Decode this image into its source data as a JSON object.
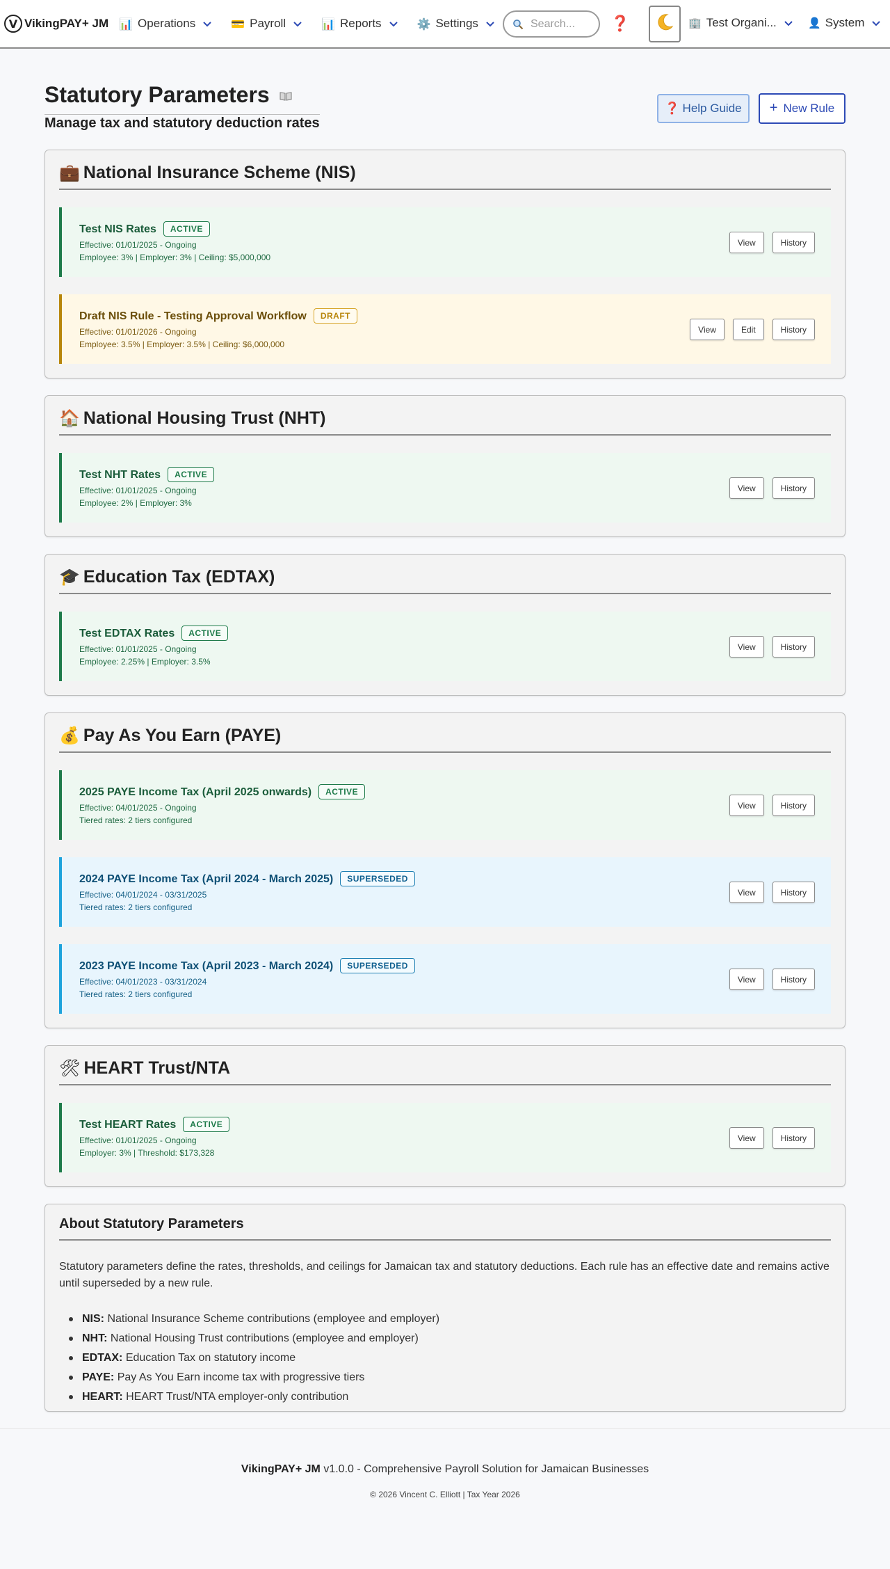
{
  "nav": {
    "brand_logo": "V",
    "brand": "VikingPAY+ JM",
    "menu": [
      {
        "icon": "📊",
        "label": "Operations"
      },
      {
        "icon": "💳",
        "label": "Payroll"
      },
      {
        "icon": "📊",
        "label": "Reports"
      },
      {
        "icon": "⚙️",
        "label": "Settings"
      }
    ],
    "search_placeholder": "Search...",
    "help_glyph": "❓",
    "theme_glyph": "🌙",
    "org": {
      "icon": "🏢",
      "label": "Test Organi..."
    },
    "user": {
      "icon": "👤",
      "label": "System"
    }
  },
  "header": {
    "title": "Statutory Parameters",
    "subtitle": "Manage tax and statutory deduction rates",
    "help_button": "Help Guide",
    "help_glyph": "❓",
    "new_button": "New Rule",
    "new_glyph": "+"
  },
  "buttons": {
    "view": "View",
    "edit": "Edit",
    "history": "History"
  },
  "sections": [
    {
      "icon": "💼",
      "title": "National Insurance Scheme (NIS)",
      "rules": [
        {
          "name": "Test NIS Rates",
          "status": "ACTIVE",
          "effective": "Effective: 01/01/2025 - Ongoing",
          "detail": "Employee: 3% | Employer: 3% | Ceiling: $5,000,000"
        },
        {
          "name": "Draft NIS Rule - Testing Approval Workflow",
          "status": "DRAFT",
          "effective": "Effective: 01/01/2026 - Ongoing",
          "detail": "Employee: 3.5% | Employer: 3.5% | Ceiling: $6,000,000"
        }
      ]
    },
    {
      "icon": "🏠",
      "title": "National Housing Trust (NHT)",
      "rules": [
        {
          "name": "Test NHT Rates",
          "status": "ACTIVE",
          "effective": "Effective: 01/01/2025 - Ongoing",
          "detail": "Employee: 2% | Employer: 3%"
        }
      ]
    },
    {
      "icon": "🎓",
      "title": "Education Tax (EDTAX)",
      "rules": [
        {
          "name": "Test EDTAX Rates",
          "status": "ACTIVE",
          "effective": "Effective: 01/01/2025 - Ongoing",
          "detail": "Employee: 2.25% | Employer: 3.5%"
        }
      ]
    },
    {
      "icon": "💰",
      "title": "Pay As You Earn (PAYE)",
      "rules": [
        {
          "name": "2025 PAYE Income Tax (April 2025 onwards)",
          "status": "ACTIVE",
          "effective": "Effective: 04/01/2025 - Ongoing",
          "detail": "Tiered rates: 2 tiers configured"
        },
        {
          "name": "2024 PAYE Income Tax (April 2024 - March 2025)",
          "status": "SUPERSEDED",
          "effective": "Effective: 04/01/2024 - 03/31/2025",
          "detail": "Tiered rates: 2 tiers configured"
        },
        {
          "name": "2023 PAYE Income Tax (April 2023 - March 2024)",
          "status": "SUPERSEDED",
          "effective": "Effective: 04/01/2023 - 03/31/2024",
          "detail": "Tiered rates: 2 tiers configured"
        }
      ]
    },
    {
      "icon": "🛠",
      "title": "HEART Trust/NTA",
      "rules": [
        {
          "name": "Test HEART Rates",
          "status": "ACTIVE",
          "effective": "Effective: 01/01/2025 - Ongoing",
          "detail": "Employer: 3% | Threshold: $173,328"
        }
      ]
    }
  ],
  "about": {
    "title": "About Statutory Parameters",
    "text": "Statutory parameters define the rates, thresholds, and ceilings for Jamaican tax and statutory deductions. Each rule has an effective date and remains active until superseded by a new rule.",
    "items": [
      {
        "term": "NIS:",
        "desc": " National Insurance Scheme contributions (employee and employer)"
      },
      {
        "term": "NHT:",
        "desc": " National Housing Trust contributions (employee and employer)"
      },
      {
        "term": "EDTAX:",
        "desc": " Education Tax on statutory income"
      },
      {
        "term": "PAYE:",
        "desc": " Pay As You Earn income tax with progressive tiers"
      },
      {
        "term": "HEART:",
        "desc": " HEART Trust/NTA employer-only contribution"
      }
    ]
  },
  "footer": {
    "brand": "VikingPAY+ JM",
    "line1": " v1.0.0 - Comprehensive Payroll Solution for Jamaican Businesses",
    "line2": "© 2026 Vincent C. Elliott | Tax Year 2026"
  },
  "colors": {
    "active": "#1e7b4a",
    "draft": "#b8860b",
    "superseded": "#1ea3dc",
    "primary": "#2d4ab5",
    "help": "#d7263d"
  }
}
